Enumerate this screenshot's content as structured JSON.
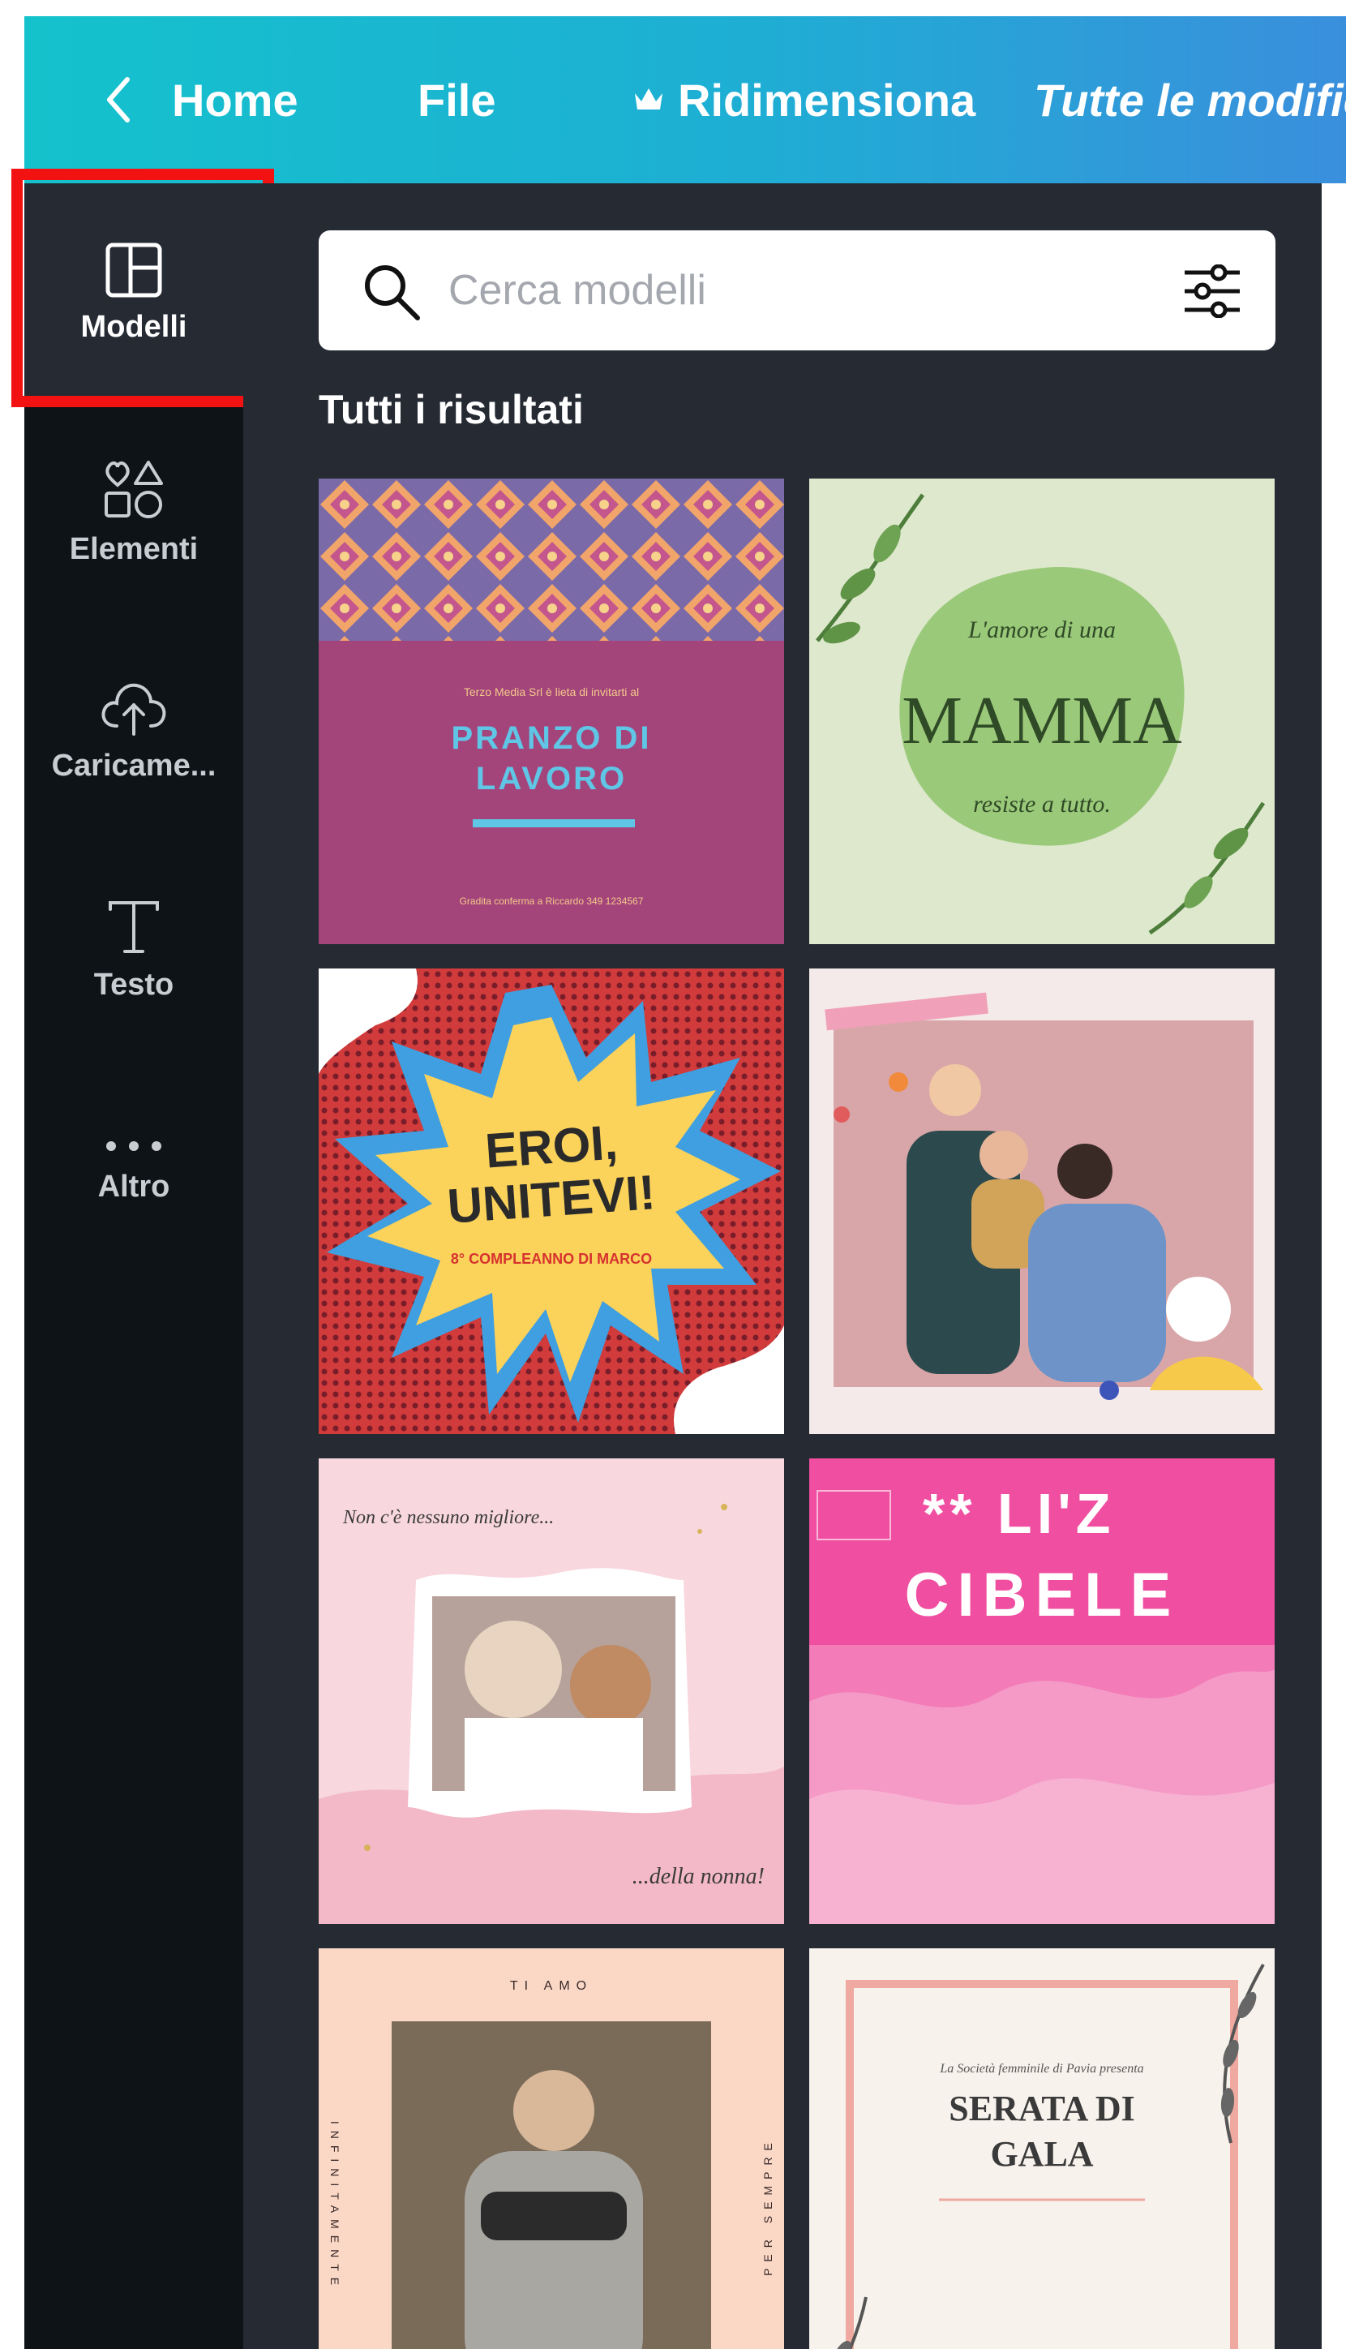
{
  "header": {
    "home_label": "Home",
    "file_label": "File",
    "resize_label": "Ridimensiona",
    "save_status": "Tutte le modifiche"
  },
  "sidebar": {
    "items": [
      {
        "label": "Modelli",
        "icon": "templates-icon"
      },
      {
        "label": "Elementi",
        "icon": "elements-icon"
      },
      {
        "label": "Caricame...",
        "icon": "upload-icon"
      },
      {
        "label": "Testo",
        "icon": "text-icon"
      },
      {
        "label": "Altro",
        "icon": "more-icon"
      }
    ]
  },
  "search": {
    "placeholder": "Cerca modelli"
  },
  "results": {
    "title": "Tutti i risultati"
  },
  "templates": [
    {
      "lines": [
        "Terzo Media Srl è lieta di invitarti al",
        "PRANZO DI",
        "LAVORO",
        "Gradita conferma a Riccardo 349 1234567"
      ]
    },
    {
      "lines": [
        "L'amore di una",
        "MAMMA",
        "resiste a tutto."
      ]
    },
    {
      "lines": [
        "EROI,",
        "UNITEVI!",
        "8° COMPLEANNO DI MARCO"
      ]
    },
    {
      "lines": []
    },
    {
      "lines": [
        "Non c'è nessuno migliore...",
        "...della nonna!"
      ]
    },
    {
      "lines": [
        "** LI'Z",
        "CIBELE"
      ]
    },
    {
      "lines": [
        "TI AMO",
        "INFINITAMENTE",
        "PER SEMPRE"
      ]
    },
    {
      "lines": [
        "La Società femminile di Pavia presenta",
        "SERATA DI",
        "GALA"
      ]
    }
  ],
  "colors": {
    "topbar_start": "#14c2cc",
    "topbar_end": "#3a8fdc",
    "sidebar_bg": "#0e1318",
    "panel_bg": "#252a33",
    "highlight": "#f21212"
  }
}
